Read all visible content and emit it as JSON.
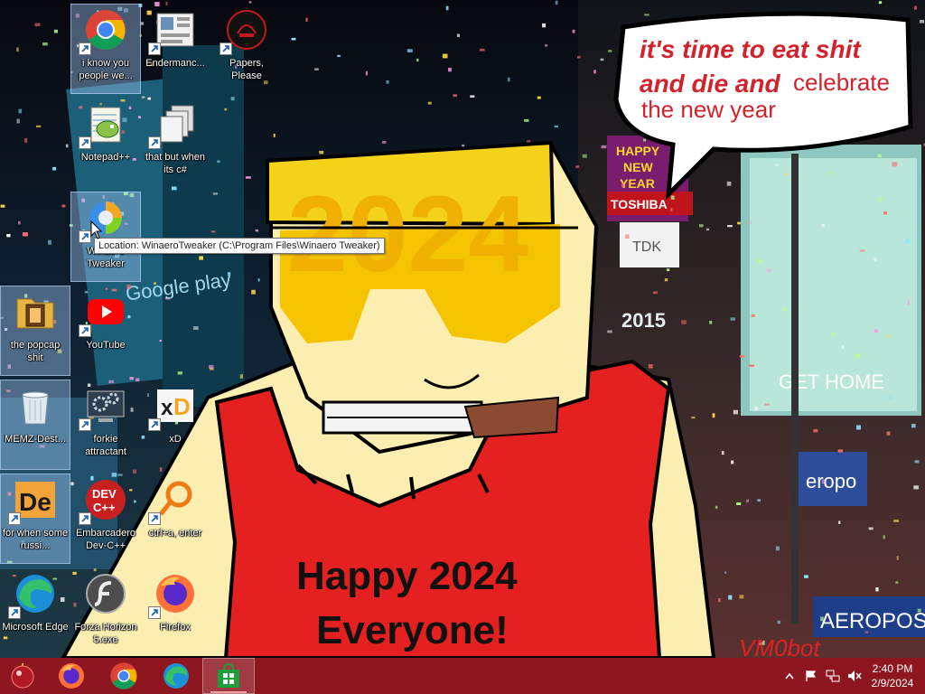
{
  "wallpaper": {
    "speech_bubble": {
      "line1": "it's time to eat shit",
      "line2a": "and die and",
      "line2b": "celebrate",
      "line3": "the new year"
    },
    "year_text": "2024",
    "caption_line1": "Happy 2024",
    "caption_line2": "Everyone!",
    "signature": "VM0bot",
    "background_signs": {
      "happy_new_year_l1": "HAPPY",
      "happy_new_year_l2": "NEW",
      "happy_new_year_l3": "YEAR",
      "toshiba": "TOSHIBA",
      "tdk": "TDK",
      "year_2015": "2015",
      "google_play": "Google play",
      "get_home": "GET HOME",
      "aeropostale_1": "eropo",
      "aeropostale_2": "AEROPOS"
    }
  },
  "desktop_icons": [
    {
      "label": "i know you people we...",
      "icon": "chrome-icon",
      "selected": true
    },
    {
      "label": "Endermanc...",
      "icon": "enderman-app-icon",
      "selected": false
    },
    {
      "label": "Papers, Please",
      "icon": "papers-please-icon",
      "selected": false
    },
    {
      "label": "Notepad++",
      "icon": "notepad-plus-plus-icon",
      "selected": false
    },
    {
      "label": "that but when its c#",
      "icon": "stack-windows-icon",
      "selected": false
    },
    {
      "label": "Winaero Tweaker",
      "icon": "winaero-tweaker-icon",
      "selected": true
    },
    {
      "label": "the popcap shit",
      "icon": "popcap-folder-icon",
      "selected": true
    },
    {
      "label": "YouTube",
      "icon": "youtube-icon",
      "selected": false
    },
    {
      "label": "MEMZ-Dest...",
      "icon": "recycle-bin-icon",
      "selected": true
    },
    {
      "label": "forkie attractant",
      "icon": "monitor-gears-icon",
      "selected": false
    },
    {
      "label": "xD",
      "icon": "xd-icon",
      "selected": false
    },
    {
      "label": "for when some russi...",
      "icon": "de-icon",
      "selected": true
    },
    {
      "label": "Embarcadero Dev-C++",
      "icon": "dev-cpp-icon",
      "selected": false
    },
    {
      "label": "ctrl+a, enter",
      "icon": "ring-icon",
      "selected": false
    },
    {
      "label": "Microsoft Edge",
      "icon": "edge-icon",
      "selected": false
    },
    {
      "label": "Forza Horizon 5.exe",
      "icon": "flash-icon",
      "selected": false
    },
    {
      "label": "Firefox",
      "icon": "firefox-icon",
      "selected": false
    }
  ],
  "tooltip": {
    "text": "Location: WinaeroTweaker (C:\\Program Files\\Winaero Tweaker)"
  },
  "taskbar": {
    "pinned": [
      "start-orb-icon",
      "firefox-icon",
      "chrome-icon",
      "edge-icon",
      "store-icon"
    ],
    "clock": {
      "time": "2:40 PM",
      "date": "2/9/2024"
    },
    "tray": [
      "show-hidden-icons-chevron",
      "action-center-flag-icon",
      "network-icon",
      "volume-muted-icon"
    ]
  },
  "colors": {
    "taskbar": "#8e1620",
    "bubble_text": "#d2222c",
    "hair": "#f5d21a",
    "shirt": "#e52020",
    "skin": "#fbeeb0"
  }
}
